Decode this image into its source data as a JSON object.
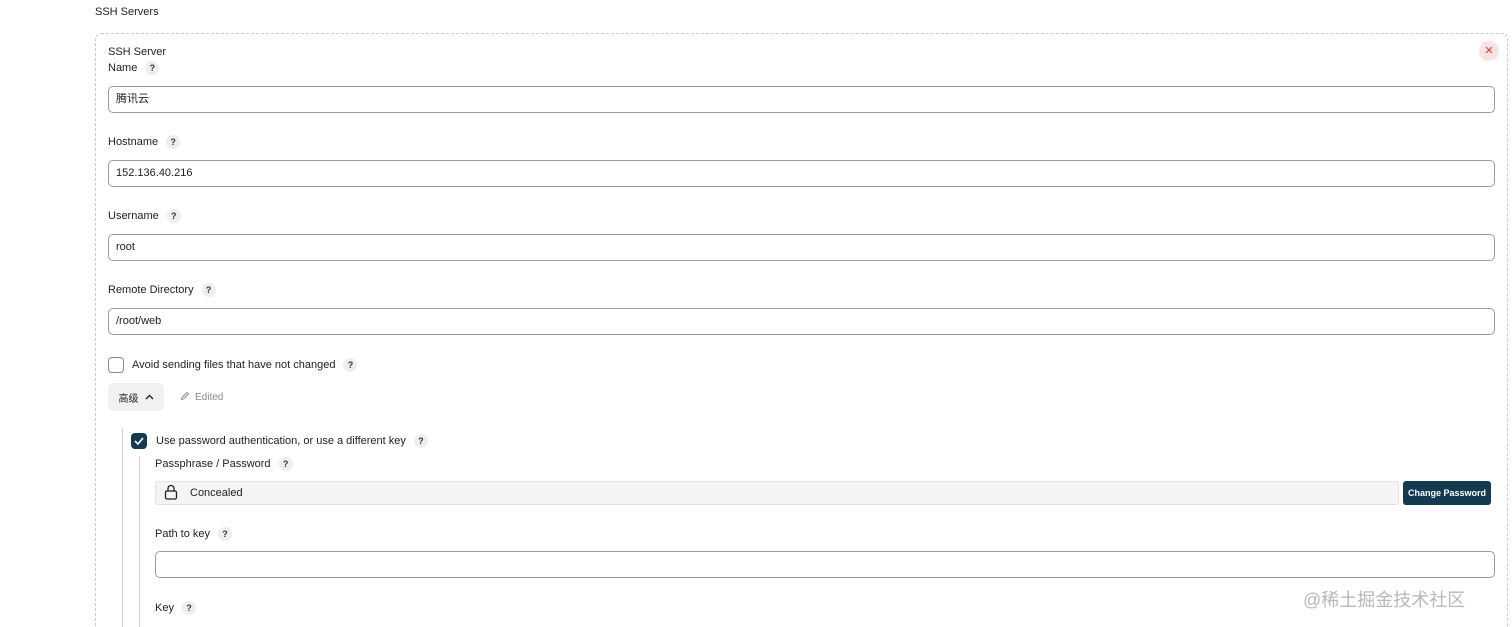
{
  "section_title": "SSH Servers",
  "server": {
    "title": "SSH Server",
    "close_icon": "close-icon",
    "fields": {
      "name": {
        "label": "Name",
        "value": "腾讯云"
      },
      "hostname": {
        "label": "Hostname",
        "value": "152.136.40.216"
      },
      "username": {
        "label": "Username",
        "value": "root"
      },
      "remote_directory": {
        "label": "Remote Directory",
        "value": "/root/web"
      }
    },
    "avoid_sending": {
      "label": "Avoid sending files that have not changed",
      "checked": false
    },
    "advanced": {
      "label": "高级",
      "edited_label": "Edited"
    },
    "use_password": {
      "label": "Use password authentication, or use a different key",
      "checked": true
    },
    "passphrase": {
      "label": "Passphrase / Password",
      "concealed_text": "Concealed",
      "change_button": "Change Password"
    },
    "path_to_key": {
      "label": "Path to key",
      "value": ""
    },
    "key": {
      "label": "Key"
    }
  },
  "help_text": "?",
  "watermark": "@稀土掘金技术社区",
  "colors": {
    "primary": "#143a52",
    "close_bg": "#fbe3e3",
    "close_fg": "#d63b3b"
  }
}
